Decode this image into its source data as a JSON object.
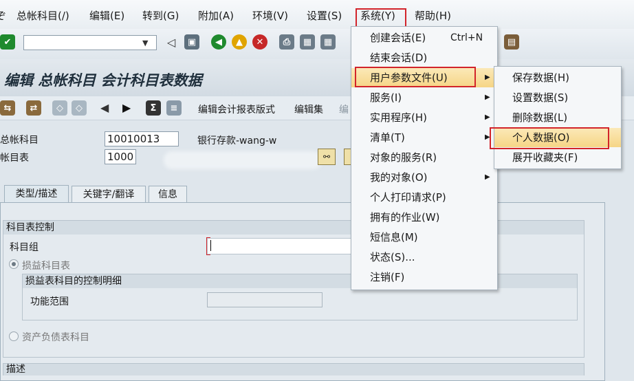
{
  "menubar": {
    "items": [
      "总帐科目(/)",
      "编辑(E)",
      "转到(G)",
      "附加(A)",
      "环境(V)",
      "设置(S)",
      "系统(Y)",
      "帮助(H)"
    ],
    "partial_icon": "ぞ"
  },
  "title": "编辑 总帐科目 会计科目表数据",
  "app_toolbar": {
    "btn1": "编辑会计报表版式",
    "btn2": "编辑集",
    "btn3": "编"
  },
  "header": {
    "gl_account_label": "总帐科目",
    "gl_account_value": "10010013",
    "gl_account_desc": "银行存款-wang-w",
    "coa_label": "帐目表",
    "coa_value": "1000"
  },
  "tabs": [
    "类型/描述",
    "关键字/翻译",
    "信息"
  ],
  "group_control": {
    "title": "科目表控制",
    "account_group_label": "科目组",
    "pl_radio": "损益科目表",
    "pl_sub_title": "损益表科目的控制明细",
    "func_area_label": "功能范围",
    "bs_radio": "资产负债表科目"
  },
  "group_desc": {
    "title": "描述"
  },
  "system_menu": {
    "items": [
      {
        "label": "创建会话(E)",
        "shortcut": "Ctrl+N"
      },
      {
        "label": "结束会话(D)",
        "shortcut": ""
      },
      {
        "label": "用户参数文件(U)",
        "shortcut": ""
      },
      {
        "label": "服务(I)",
        "shortcut": ""
      },
      {
        "label": "实用程序(H)",
        "shortcut": ""
      },
      {
        "label": "清单(T)",
        "shortcut": ""
      },
      {
        "label": "对象的服务(R)",
        "shortcut": ""
      },
      {
        "label": "我的对象(O)",
        "shortcut": ""
      },
      {
        "label": "个人打印请求(P)",
        "shortcut": ""
      },
      {
        "label": "拥有的作业(W)",
        "shortcut": ""
      },
      {
        "label": "短信息(M)",
        "shortcut": ""
      },
      {
        "label": "状态(S)...",
        "shortcut": ""
      },
      {
        "label": "注销(F)",
        "shortcut": ""
      }
    ]
  },
  "profile_submenu": {
    "items": [
      "保存数据(H)",
      "设置数据(S)",
      "删除数据(L)",
      "个人数据(O)",
      "展开收藏夹(F)"
    ]
  },
  "colors": {
    "highlight": "#f6d586",
    "red_box": "#d2232a",
    "ok_green": "#1f8a2e",
    "cancel_red": "#c62828"
  }
}
